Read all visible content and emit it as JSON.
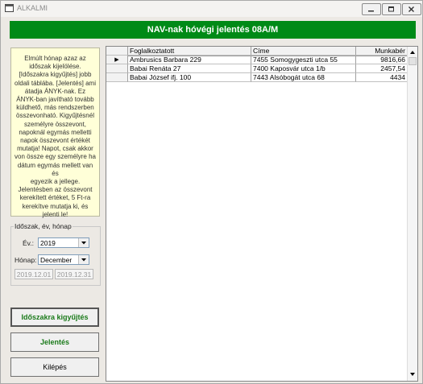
{
  "window": {
    "title": "ALKALMI",
    "controls": [
      "minimize",
      "restore",
      "close"
    ]
  },
  "header": {
    "title": "NAV-nak hóvégi jelentés 08A/M"
  },
  "info_text": "Elmúlt hónap azaz az\nidőszak kijelölése.\n[Időszakra kigyűjtés] jobb\noldali táblába. [Jelentés] ami\nátadja ÁNYK-nak. Ez\nÁNYK-ban javítható tovább\nküldhető, más rendszerben\nösszevonható. Kigyűjtésnél\nszemélyre összevont,\nnapoknál egymás melletti\nnapok összevont értékét\nmutatja! Napot, csak akkor\nvon össze egy személyre ha\ndátum egymás mellett van és\negyezik a jellege.\nJelentésben az összevont\nkerekített értéket, 5 Ft-ra\nkerekítve mutatja ki, és\njelenti le!",
  "period": {
    "group_label": "Időszak, év, hónap",
    "year_label": "Év.:",
    "year_value": "2019",
    "month_label": "Hónap:",
    "month_value": "December",
    "date_from": "2019.12.01",
    "date_to": "2019.12.31"
  },
  "buttons": {
    "collect": "Időszakra kigyűjtés",
    "report": "Jelentés",
    "exit": "Kilépés"
  },
  "table": {
    "columns": [
      "Foglalkoztatott",
      "Címe",
      "Munkabér"
    ],
    "rows": [
      {
        "indicator": "▶",
        "name": "Ambrusics  Barbara 229",
        "address": "7455 Somogygeszti utca 55",
        "wage": "9816,66"
      },
      {
        "indicator": "",
        "name": "Babai  Renáta 27",
        "address": "7400 Kaposvár utca 1/b",
        "wage": "2457,54"
      },
      {
        "indicator": "",
        "name": "Babai József ifj. 100",
        "address": "7443 Alsóbogát utca 68",
        "wage": "4434"
      }
    ]
  }
}
